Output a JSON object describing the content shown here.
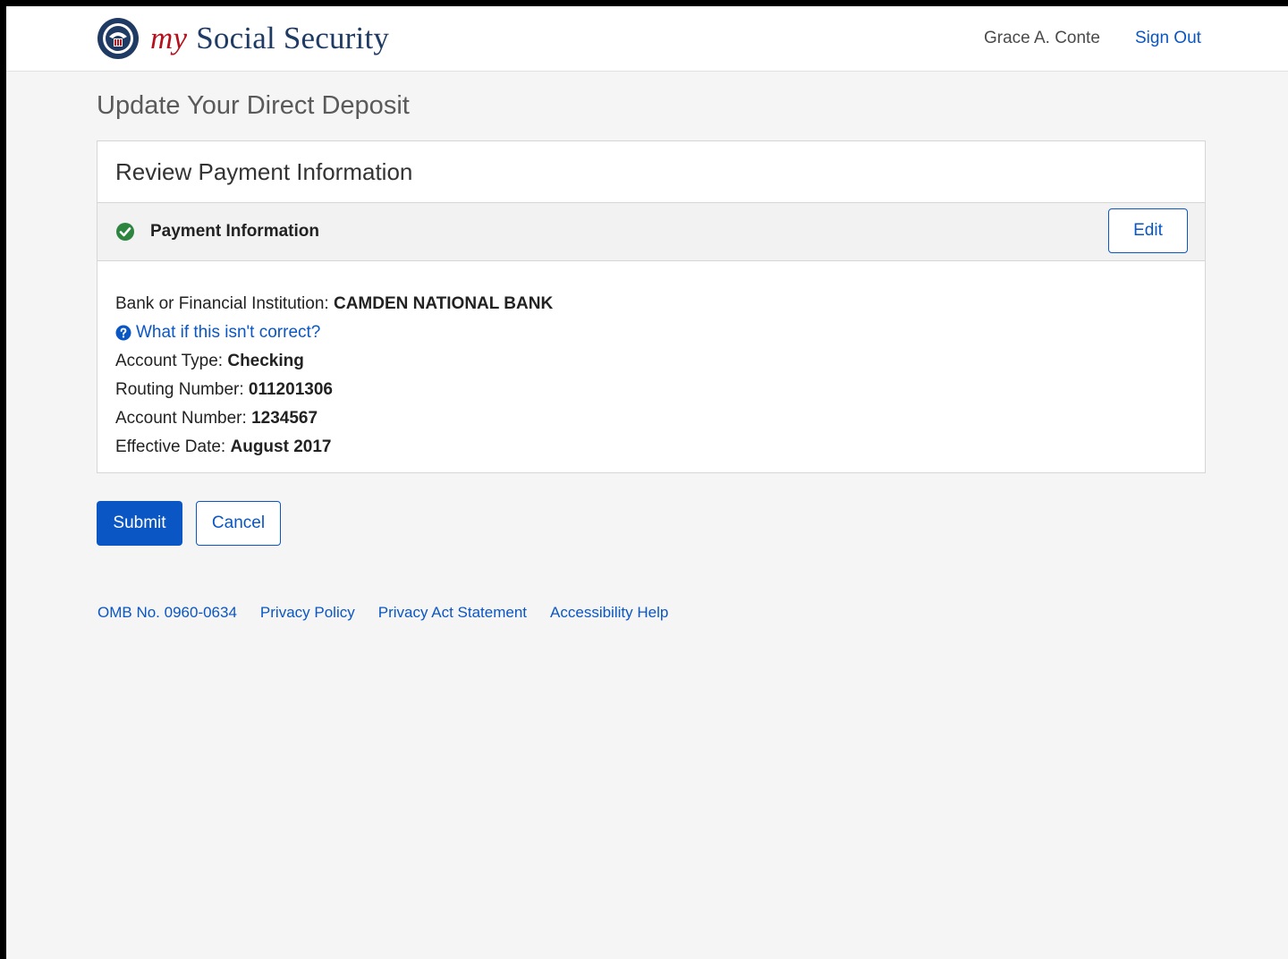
{
  "header": {
    "brand_my": "my",
    "brand_name": "Social Security",
    "user_name": "Grace A. Conte",
    "sign_out_label": "Sign Out"
  },
  "page": {
    "title": "Update Your Direct Deposit"
  },
  "card": {
    "title": "Review Payment Information",
    "section_label": "Payment Information",
    "section_status_icon": "check-circle-icon",
    "edit_label": "Edit",
    "help_link": "What if this isn't correct?",
    "fields": [
      {
        "label": "Bank or Financial Institution:",
        "value": "CAMDEN NATIONAL BANK"
      },
      {
        "label": "Account Type:",
        "value": "Checking"
      },
      {
        "label": "Routing Number:",
        "value": "011201306"
      },
      {
        "label": "Account Number:",
        "value": "1234567"
      },
      {
        "label": "Effective Date:",
        "value": "August 2017"
      }
    ]
  },
  "actions": {
    "submit_label": "Submit",
    "cancel_label": "Cancel"
  },
  "footer": {
    "links": [
      "OMB No. 0960-0634",
      "Privacy Policy",
      "Privacy Act Statement",
      "Accessibility Help"
    ]
  },
  "colors": {
    "link_blue": "#0a56c4",
    "brand_red": "#b3111e",
    "brand_navy": "#1f3a63",
    "success_green": "#2e8540"
  }
}
